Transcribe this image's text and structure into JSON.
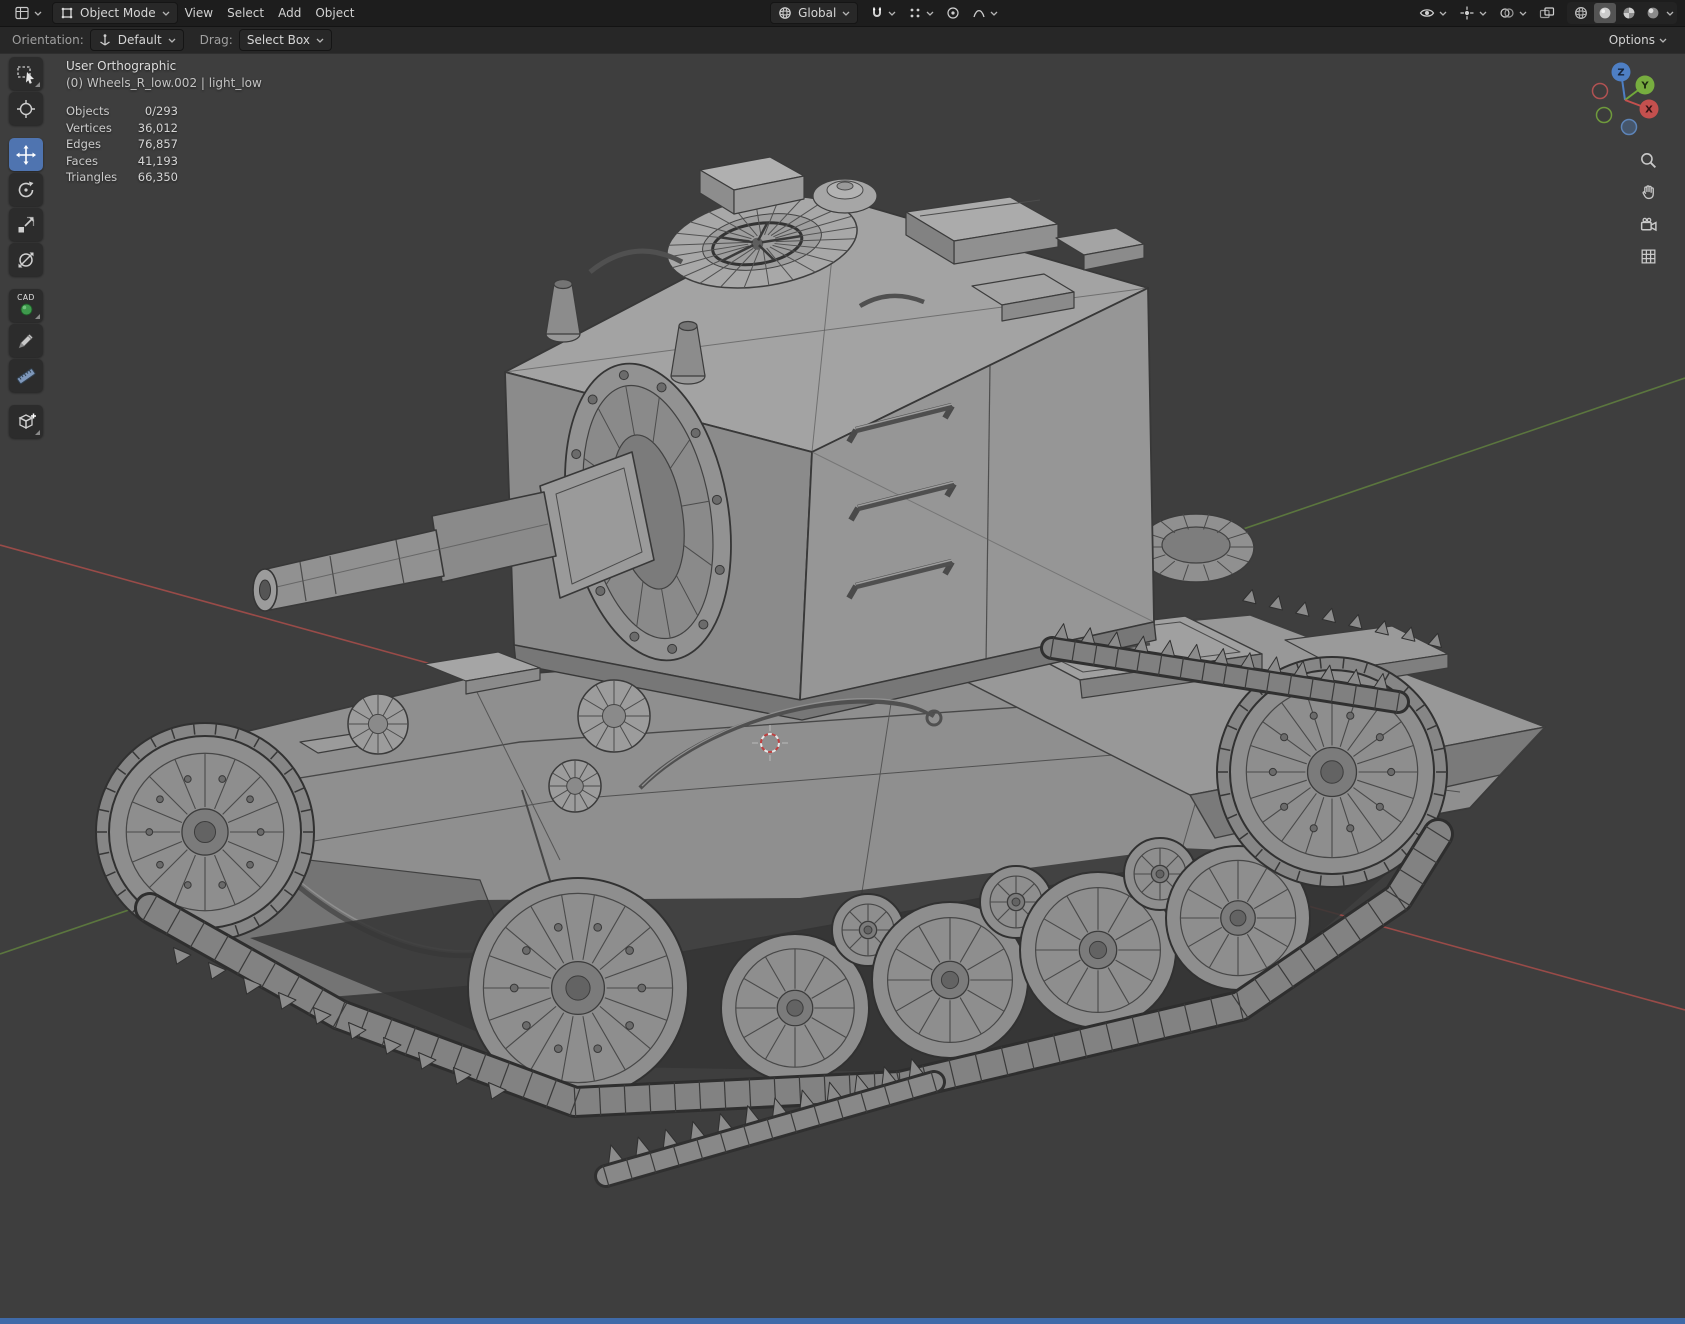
{
  "colors": {
    "accent_blue": "#4f74b0",
    "axis_x_red": "#a34d4a",
    "axis_y_green": "#5f7d3e",
    "viewport_background": "#3e3e3e",
    "header_background": "#1d1d1d",
    "bottom_strip_blue": "#3f6aa8"
  },
  "icons": {
    "header_left": [
      "editor-type-icon",
      "object-mode-icon"
    ],
    "header_center": [
      "globe-icon",
      "magnet-icon",
      "snap-target-icon",
      "proportional-editing-icon",
      "falloff-curve-icon"
    ],
    "header_right": [
      "visibility-eye-icon",
      "gizmo-icon",
      "overlays-icon",
      "xray-icon",
      "shading-wireframe-icon",
      "shading-solid-icon",
      "shading-material-icon",
      "shading-rendered-icon"
    ],
    "left_toolbar": [
      "select-box-icon",
      "cursor-icon",
      "move-icon",
      "rotate-icon",
      "scale-icon",
      "transform-icon",
      "cad-sphere-icon",
      "annotate-pencil-icon",
      "measure-ruler-icon",
      "add-cube-icon"
    ],
    "viewport_right": [
      "zoom-icon",
      "pan-hand-icon",
      "camera-icon",
      "grid-icon"
    ]
  },
  "topbar": {
    "mode_label": "Object Mode",
    "menus": [
      {
        "label": "View"
      },
      {
        "label": "Select"
      },
      {
        "label": "Add"
      },
      {
        "label": "Object"
      }
    ],
    "orientation_label": "Global"
  },
  "tool_settings": {
    "orientation_label": "Orientation:",
    "orientation_value": "Default",
    "drag_label": "Drag:",
    "drag_value": "Select Box",
    "options_label": "Options"
  },
  "left_toolbar": {
    "active_tool": "move-tool",
    "cad_label": "CAD"
  },
  "viewport": {
    "view_name": "User Orthographic",
    "active_object": "(0) Wheels_R_low.002 | light_low",
    "stats": {
      "rows": [
        {
          "label": "Objects",
          "value": "0/293"
        },
        {
          "label": "Vertices",
          "value": "36,012"
        },
        {
          "label": "Edges",
          "value": "76,857"
        },
        {
          "label": "Faces",
          "value": "41,193"
        },
        {
          "label": "Triangles",
          "value": "66,350"
        }
      ]
    },
    "nav_gizmo": {
      "z_label": "Z",
      "y_label": "Y",
      "x_label": "X"
    }
  }
}
